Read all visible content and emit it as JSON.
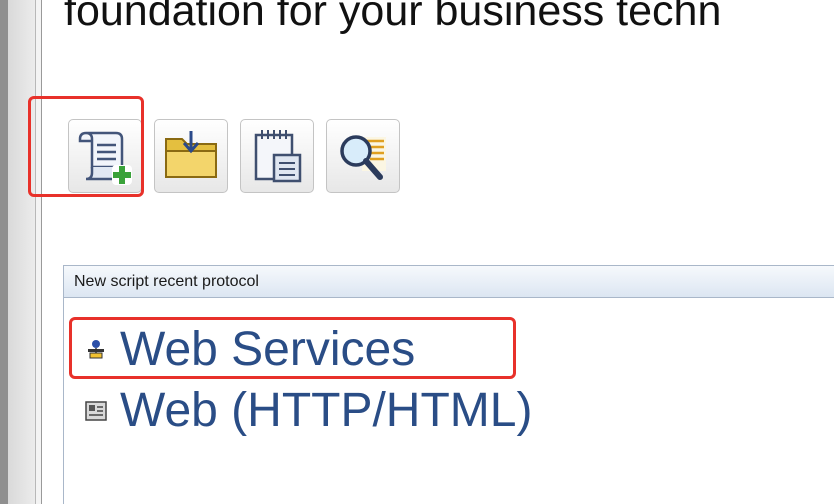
{
  "page": {
    "headline": "foundation for your business techn"
  },
  "toolbar": {
    "buttons": [
      {
        "name": "new-script",
        "icon": "new-script-icon"
      },
      {
        "name": "open-script",
        "icon": "folder-open-icon"
      },
      {
        "name": "notepad",
        "icon": "notepad-icon"
      },
      {
        "name": "search",
        "icon": "magnifier-icon"
      }
    ]
  },
  "recent_panel": {
    "title": "New script recent protocol",
    "items": [
      {
        "label": "Web Services",
        "icon": "web-services-icon"
      },
      {
        "label": "Web (HTTP/HTML)",
        "icon": "web-http-icon"
      }
    ]
  },
  "colors": {
    "highlight": "#e8312a",
    "link": "#2a4d86",
    "panel_header": "#dce6f2"
  }
}
